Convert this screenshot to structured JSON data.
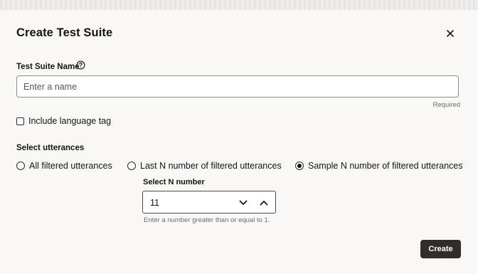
{
  "dialog": {
    "title": "Create Test Suite"
  },
  "name_field": {
    "label": "Test Suite Name",
    "placeholder": "Enter a name",
    "value": "",
    "required_text": "Required"
  },
  "language_tag": {
    "label": "Include language tag",
    "checked": false
  },
  "utterances": {
    "label": "Select utterances",
    "options": [
      {
        "label": "All filtered utterances",
        "selected": false
      },
      {
        "label": "Last N number of filtered utterances",
        "selected": false
      },
      {
        "label": "Sample N number of filtered utterances",
        "selected": true
      }
    ]
  },
  "n_number": {
    "label": "Select N number",
    "value": "11",
    "hint": "Enter a number greater than or equal to 1."
  },
  "footer": {
    "create_label": "Create"
  },
  "icons": {
    "close": "close-icon",
    "help": "help-icon",
    "decrement": "chevron-down-icon",
    "increment": "chevron-up-icon"
  }
}
